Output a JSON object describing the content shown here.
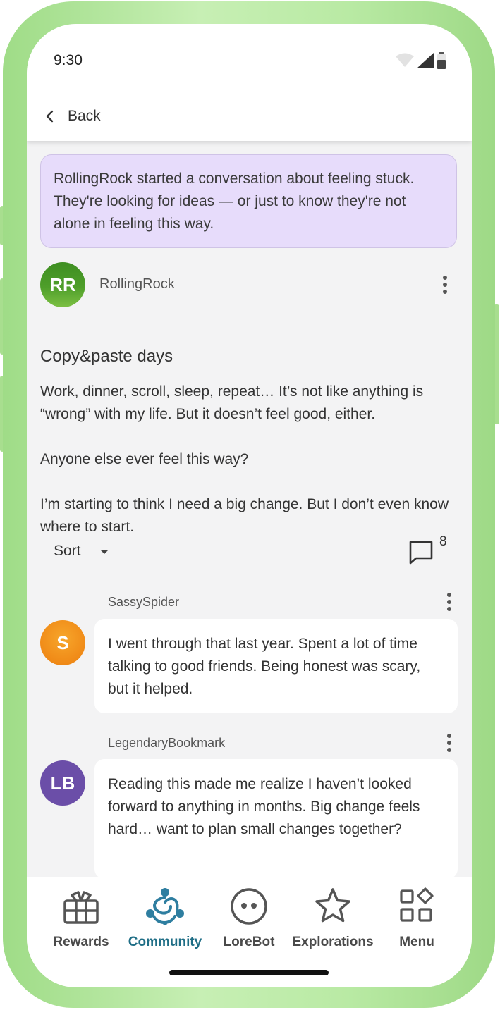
{
  "status_bar": {
    "time": "9:30"
  },
  "header": {
    "back_label": "Back"
  },
  "summary": "RollingRock started a conversation about feeling stuck. They're looking for ideas — or just to know they're not alone in feeling this way.",
  "post": {
    "avatar_initials": "RR",
    "author": "RollingRock",
    "title": "Copy&paste days",
    "paragraphs": [
      "Work, dinner, scroll, sleep, repeat… It’s not like anything is “wrong” with my life. But it doesn’t feel good, either.",
      "Anyone else ever feel this way?",
      "I’m starting to think I need a big change. But I don’t even know where to start."
    ]
  },
  "sort": {
    "label": "Sort",
    "comment_count": "8"
  },
  "comments": [
    {
      "author": "SassySpider",
      "initials": "S",
      "text": "I went through that last year. Spent a lot of time talking to good friends. Being honest was scary, but it helped."
    },
    {
      "author": "LegendaryBookmark",
      "initials": "LB",
      "text": "Reading this made me realize I haven’t looked forward to anything in months. Big change feels hard… want to plan small changes together?"
    }
  ],
  "nav": [
    {
      "label": "Rewards",
      "icon": "gift-icon"
    },
    {
      "label": "Community",
      "icon": "community-icon"
    },
    {
      "label": "LoreBot",
      "icon": "lorebot-icon"
    },
    {
      "label": "Explorations",
      "icon": "star-icon"
    },
    {
      "label": "Menu",
      "icon": "grid-menu-icon"
    }
  ],
  "colors": {
    "phone_frame": "#b9eaa4",
    "summary_bg": "#e7dcfb",
    "active_nav": "#1f6e86",
    "avatar_rr": "#4e9e2a",
    "avatar_s": "#f08a17",
    "avatar_lb": "#6b4ea8"
  }
}
